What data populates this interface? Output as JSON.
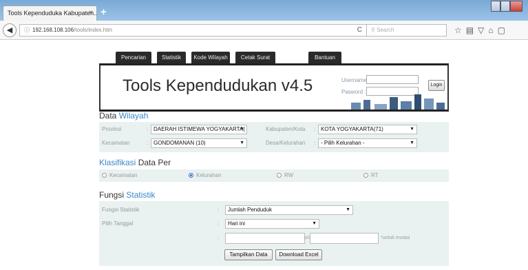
{
  "browser": {
    "tab_title": "Tools Kependuduka Kabupaten...",
    "tab_close": "×",
    "new_tab": "+",
    "url_host": "192.168.108.106",
    "url_path": "/tools/index.htm",
    "search_placeholder": "Search",
    "reload_icon": "C"
  },
  "menu": {
    "items": [
      "Pencarian Data",
      "Statistik",
      "Kode Wilayah",
      "Cetak Surat",
      "Bantuan"
    ]
  },
  "banner": {
    "title": "Tools Kependudukan v4.5",
    "username_label": "Username :",
    "password_label": "Pasword :",
    "login_button": "Login"
  },
  "wilayah": {
    "title_main": "Data",
    "title_highlight": "Wilayah",
    "provinsi_label": "Provinsi",
    "provinsi_value": "DAERAH ISTIMEWA YOGYAKARTA(",
    "kabupaten_label": "Kabupaten/Kota",
    "kabupaten_value": "KOTA YOGYAKARTA(71)",
    "kecamatan_label": "Kecamatan",
    "kecamatan_value": "GONDOMANAN (10)",
    "desa_label": "Desa/Kelurahan",
    "desa_value": "- Pilih Kelurahan -"
  },
  "klasifikasi": {
    "title_highlight": "Klasifikasi",
    "title_main": "Data Per",
    "options": [
      "Kecamatan",
      "Kelurahan",
      "RW",
      "RT"
    ],
    "selected_index": 1
  },
  "statistik": {
    "title_main": "Fungsi",
    "title_highlight": "Statistik",
    "fungsi_label": "Fungsi Statistik",
    "fungsi_value": "Jumlah Penduduk",
    "tanggal_label": "Pilih Tanggal",
    "tanggal_value": "Hari ini",
    "range_sep": "s/d",
    "note": "*untuk mutasi",
    "show_button": "Tampilkan Data",
    "download_button": "Download Excel"
  }
}
